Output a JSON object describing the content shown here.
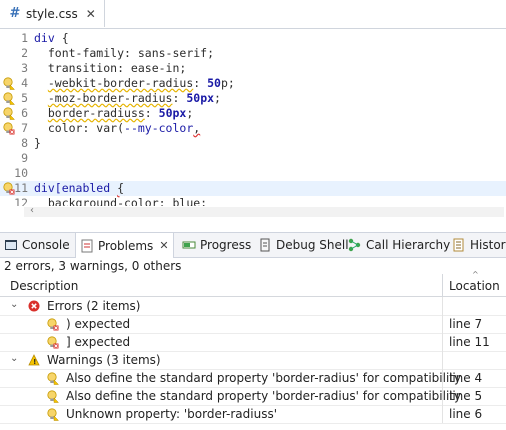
{
  "editor": {
    "tab_icon_glyph": "#",
    "tab_label": "style.css",
    "lines": [
      {
        "n": "1",
        "marker": "",
        "parts": [
          {
            "t": "div",
            "c": "sel"
          },
          {
            "t": " {",
            "c": ""
          }
        ]
      },
      {
        "n": "2",
        "marker": "",
        "parts": [
          {
            "t": "  font-family: sans-serif;",
            "c": ""
          }
        ]
      },
      {
        "n": "3",
        "marker": "",
        "parts": [
          {
            "t": "  transition: ease-in;",
            "c": ""
          }
        ]
      },
      {
        "n": "4",
        "marker": "warning",
        "parts": [
          {
            "t": "  ",
            "c": ""
          },
          {
            "t": "-webkit-border-radius",
            "c": "warn-ul"
          },
          {
            "t": ": ",
            "c": ""
          },
          {
            "t": "50",
            "c": "num"
          },
          {
            "t": "p;",
            "c": ""
          }
        ]
      },
      {
        "n": "5",
        "marker": "warning",
        "parts": [
          {
            "t": "  ",
            "c": ""
          },
          {
            "t": "-moz-border-radius",
            "c": "warn-ul"
          },
          {
            "t": ": ",
            "c": ""
          },
          {
            "t": "50px",
            "c": "num"
          },
          {
            "t": ";",
            "c": ""
          }
        ]
      },
      {
        "n": "6",
        "marker": "warning",
        "parts": [
          {
            "t": "  ",
            "c": ""
          },
          {
            "t": "border-radiuss",
            "c": "warn-ul"
          },
          {
            "t": ": ",
            "c": ""
          },
          {
            "t": "50px",
            "c": "num"
          },
          {
            "t": ";",
            "c": ""
          }
        ]
      },
      {
        "n": "7",
        "marker": "error",
        "parts": [
          {
            "t": "  color: var(",
            "c": ""
          },
          {
            "t": "--my-color",
            "c": "sel"
          },
          {
            "t": ",",
            "c": "err-ul"
          }
        ]
      },
      {
        "n": "8",
        "marker": "",
        "parts": [
          {
            "t": "}",
            "c": ""
          }
        ]
      },
      {
        "n": "9",
        "marker": "",
        "parts": [
          {
            "t": "",
            "c": ""
          }
        ]
      },
      {
        "n": "10",
        "marker": "",
        "parts": [
          {
            "t": "",
            "c": ""
          }
        ]
      },
      {
        "n": "11",
        "marker": "error",
        "parts": [
          {
            "t": "div[enabled ",
            "c": "sel"
          },
          {
            "t": "{",
            "c": "err-ul"
          }
        ]
      },
      {
        "n": "12",
        "marker": "",
        "parts": [
          {
            "t": "  background-color: blue;",
            "c": ""
          }
        ]
      }
    ]
  },
  "views": {
    "tabs": [
      {
        "id": "console",
        "label": "Console",
        "active": false,
        "icon": "console-icon"
      },
      {
        "id": "problems",
        "label": "Problems",
        "active": true,
        "icon": "problems-icon"
      },
      {
        "id": "progress",
        "label": "Progress",
        "active": false,
        "icon": "progress-icon"
      },
      {
        "id": "debug-shell",
        "label": "Debug Shell",
        "active": false,
        "icon": "debug-shell-icon"
      },
      {
        "id": "call-hierarchy",
        "label": "Call Hierarchy",
        "active": false,
        "icon": "call-hierarchy-icon"
      },
      {
        "id": "history",
        "label": "History",
        "active": false,
        "icon": "history-icon"
      }
    ]
  },
  "problems": {
    "summary": "2 errors, 3 warnings, 0 others",
    "col_description": "Description",
    "col_location": "Location",
    "groups": [
      {
        "type": "error",
        "label": "Errors (2 items)",
        "items": [
          {
            "text": ") expected",
            "location": "line 7"
          },
          {
            "text": "] expected",
            "location": "line 11"
          }
        ]
      },
      {
        "type": "warning",
        "label": "Warnings (3 items)",
        "items": [
          {
            "text": "Also define the standard property 'border-radius' for compatibility",
            "location": "line 4"
          },
          {
            "text": "Also define the standard property 'border-radius' for compatibility",
            "location": "line 5"
          },
          {
            "text": "Unknown property: 'border-radiuss'",
            "location": "line 6"
          }
        ]
      }
    ]
  }
}
